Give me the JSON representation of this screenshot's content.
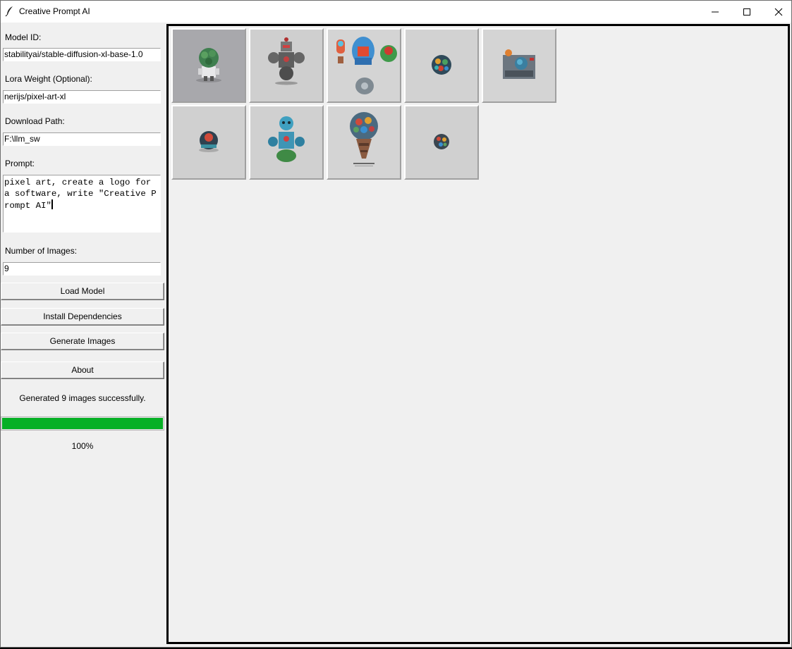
{
  "window": {
    "title": "Creative Prompt AI"
  },
  "form": {
    "model_id_label": "Model ID:",
    "model_id_value": "stabilityai/stable-diffusion-xl-base-1.0",
    "lora_label": "Lora Weight (Optional):",
    "lora_value": "nerijs/pixel-art-xl",
    "download_label": "Download Path:",
    "download_value": "F:\\llm_sw",
    "prompt_label": "Prompt:",
    "prompt_value": "pixel art, create a logo for a software, write \"Creative Prompt AI\"",
    "num_images_label": "Number of Images:",
    "num_images_value": "9"
  },
  "buttons": {
    "load_model": "Load Model",
    "install_deps": "Install Dependencies",
    "generate": "Generate Images",
    "about": "About"
  },
  "status": {
    "message": "Generated 9 images successfully.",
    "progress_percent": 100,
    "progress_label": "100%",
    "progress_color": "#06b025"
  },
  "gallery": {
    "images": [
      {
        "subject": "green-brain-robot-sprite"
      },
      {
        "subject": "grey-muscle-robot-sprite"
      },
      {
        "subject": "character-sprite-sheet"
      },
      {
        "subject": "small-orb-sprite"
      },
      {
        "subject": "keyboard-device-sprite"
      },
      {
        "subject": "round-bot-sprite"
      },
      {
        "subject": "blue-robot-sprite"
      },
      {
        "subject": "lightbulb-tower-sprite"
      },
      {
        "subject": "tiny-orb-sprite"
      }
    ]
  }
}
